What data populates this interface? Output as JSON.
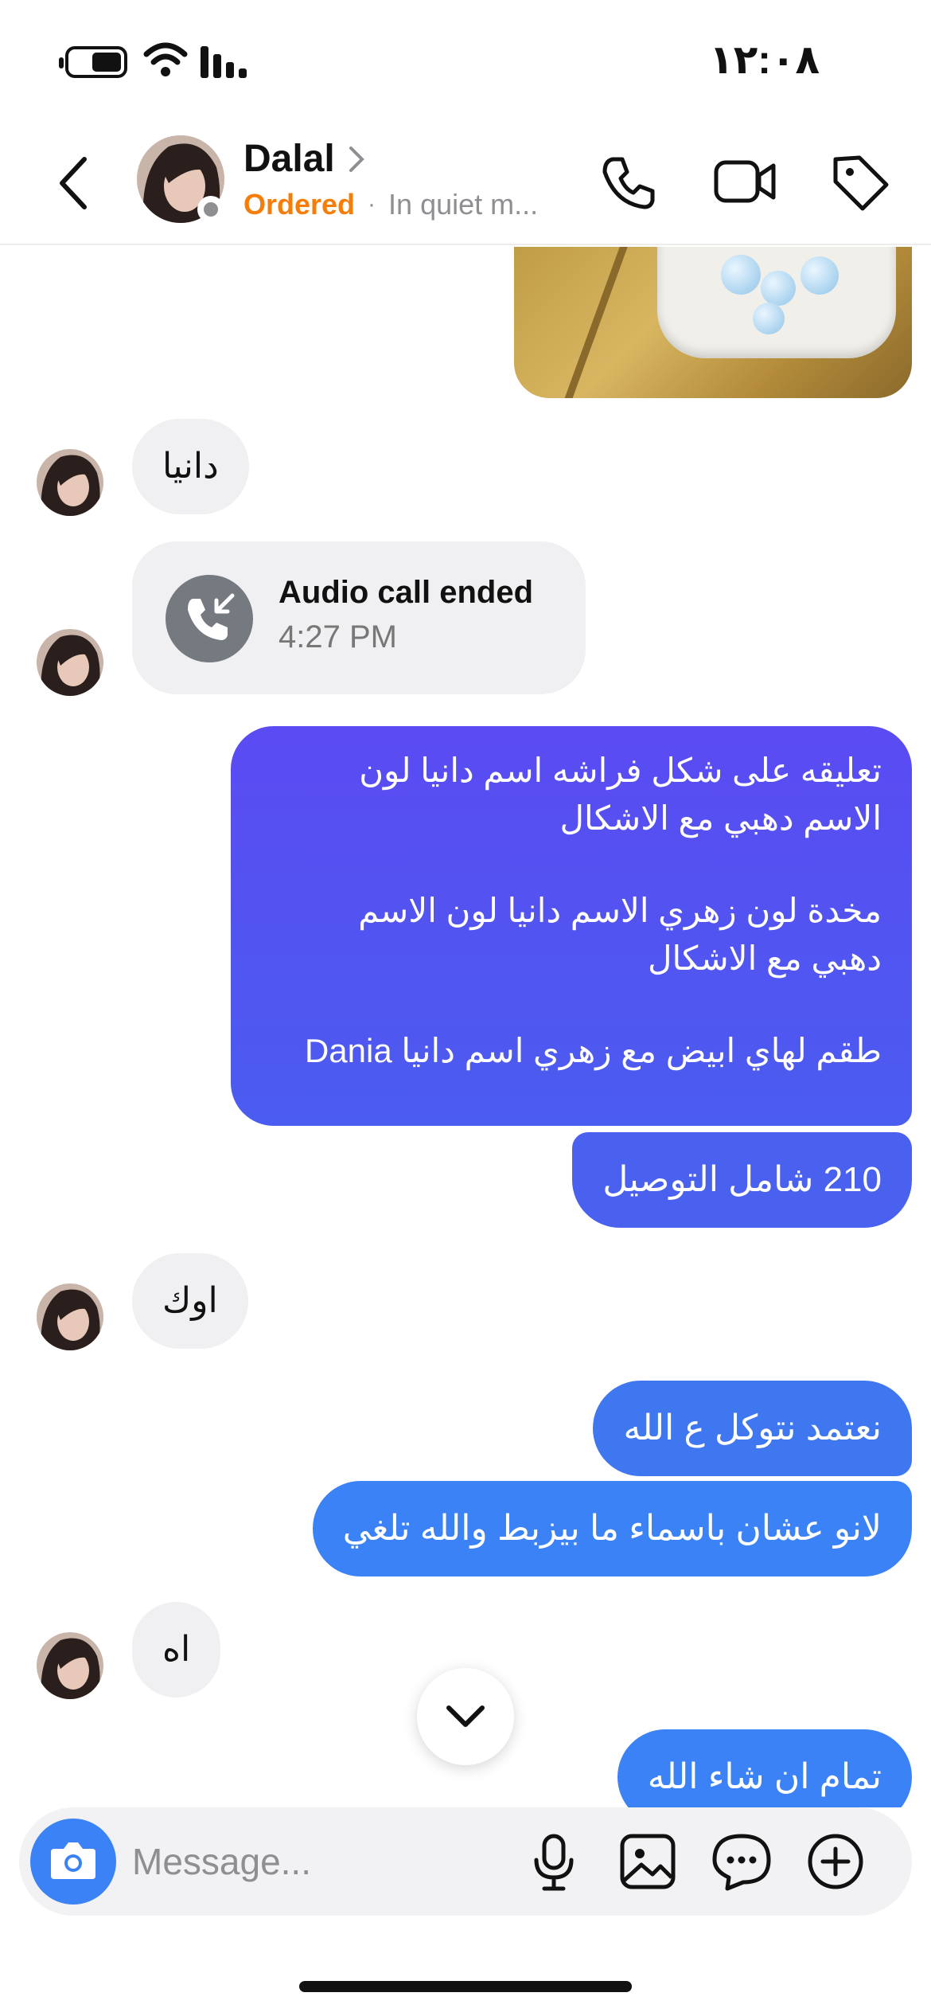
{
  "status_bar": {
    "time": "١٢:٠٨"
  },
  "header": {
    "name": "Dalal",
    "status": "Ordered",
    "separator": "·",
    "activity": "In quiet m..."
  },
  "messages": {
    "m1": "دانيا",
    "call": {
      "title": "Audio call ended",
      "time": "4:27 PM"
    },
    "m2_lines": [
      "تعليقه على شكل فراشه اسم دانيا لون",
      "الاسم دهبي مع الاشكال",
      "",
      "مخدة لون زهري الاسم دانيا لون الاسم",
      "دهبي مع الاشكال",
      "",
      "طقم لهاي ابيض مع زهري اسم دانيا Dania"
    ],
    "m3": "210 شامل التوصيل",
    "m4": "اوك",
    "m5": "نعتمد نتوكل ع الله",
    "m6": "لانو عشان باسماء ما بيزبط والله تلغي",
    "m7": "اه",
    "m8": "تمام ان شاء الله"
  },
  "composer": {
    "placeholder": "Message..."
  },
  "colors": {
    "accent": "#3b82f6",
    "ordered": "#f77d0a",
    "incoming": "#f0f0f2"
  }
}
